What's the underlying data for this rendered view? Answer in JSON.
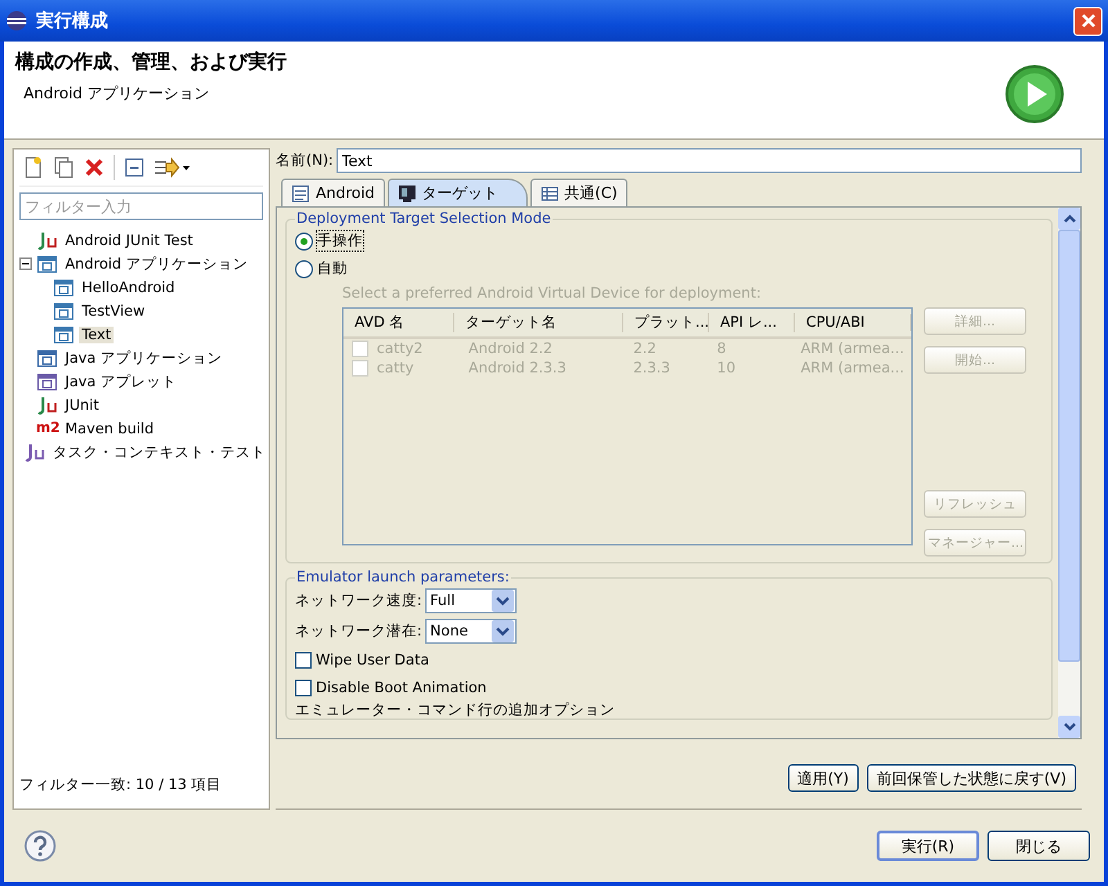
{
  "window": {
    "title": "実行構成"
  },
  "header": {
    "title": "構成の作成、管理、および実行",
    "subtitle": "Android アプリケーション"
  },
  "filter": {
    "placeholder": "フィルター入力"
  },
  "tree": [
    {
      "label": "Android JUnit Test",
      "kind": "android-junit",
      "selected": false
    },
    {
      "label": "Android アプリケーション",
      "kind": "android",
      "selected": false,
      "expanded": true,
      "children": [
        {
          "label": "HelloAndroid",
          "kind": "android",
          "selected": false
        },
        {
          "label": "TestView",
          "kind": "android",
          "selected": false
        },
        {
          "label": "Text",
          "kind": "android",
          "selected": true
        }
      ]
    },
    {
      "label": "Java アプリケーション",
      "kind": "java",
      "selected": false
    },
    {
      "label": "Java アプレット",
      "kind": "applet",
      "selected": false
    },
    {
      "label": "JUnit",
      "kind": "junit",
      "selected": false
    },
    {
      "label": "Maven build",
      "kind": "maven",
      "badge": "m2",
      "selected": false
    },
    {
      "label": "タスク・コンテキスト・テスト",
      "kind": "task",
      "selected": false
    }
  ],
  "filter_status": "フィルター一致: 10 / 13 項目",
  "name_field": {
    "label": "名前(N):",
    "value": "Text"
  },
  "tabs": [
    {
      "label": "Android",
      "kind": "doc",
      "selected": false
    },
    {
      "label": "ターゲット",
      "kind": "device",
      "selected": true
    },
    {
      "label": "共通(C)",
      "kind": "table",
      "selected": false
    }
  ],
  "deployment": {
    "title": "Deployment Target Selection Mode",
    "radios": [
      {
        "label": "手操作",
        "selected": true
      },
      {
        "label": "自動",
        "selected": false
      }
    ],
    "hint": "Select a preferred Android Virtual Device for deployment:",
    "avd_table": {
      "disabled": true,
      "columns": [
        "AVD 名",
        "ターゲット名",
        "プラット...",
        "API レ...",
        "CPU/ABI"
      ],
      "rows": [
        {
          "checked": false,
          "cells": [
            "catty2",
            "Android 2.2",
            "2.2",
            "8",
            "ARM (armea..."
          ]
        },
        {
          "checked": false,
          "cells": [
            "catty",
            "Android 2.3.3",
            "2.3.3",
            "10",
            "ARM (armea..."
          ]
        }
      ]
    },
    "buttons": [
      {
        "label": "詳細...",
        "disabled": true
      },
      {
        "label": "開始...",
        "disabled": true
      },
      {
        "label": "リフレッシュ",
        "disabled": true
      },
      {
        "label": "マネージャー...",
        "disabled": true
      }
    ]
  },
  "emulator": {
    "title": "Emulator launch parameters:",
    "selects": [
      {
        "label": "ネットワーク速度:",
        "value": "Full"
      },
      {
        "label": "ネットワーク潜在:",
        "value": "None"
      }
    ],
    "checkboxes": [
      {
        "label": "Wipe User Data",
        "checked": false
      },
      {
        "label": "Disable Boot Animation",
        "checked": false
      }
    ],
    "extra_options": "エミュレーター・コマンド行の追加オプション"
  },
  "form_buttons": [
    "適用(Y)",
    "前回保管した状態に戻す(V)"
  ],
  "dialog_buttons": [
    "実行(R)",
    "閉じる"
  ]
}
